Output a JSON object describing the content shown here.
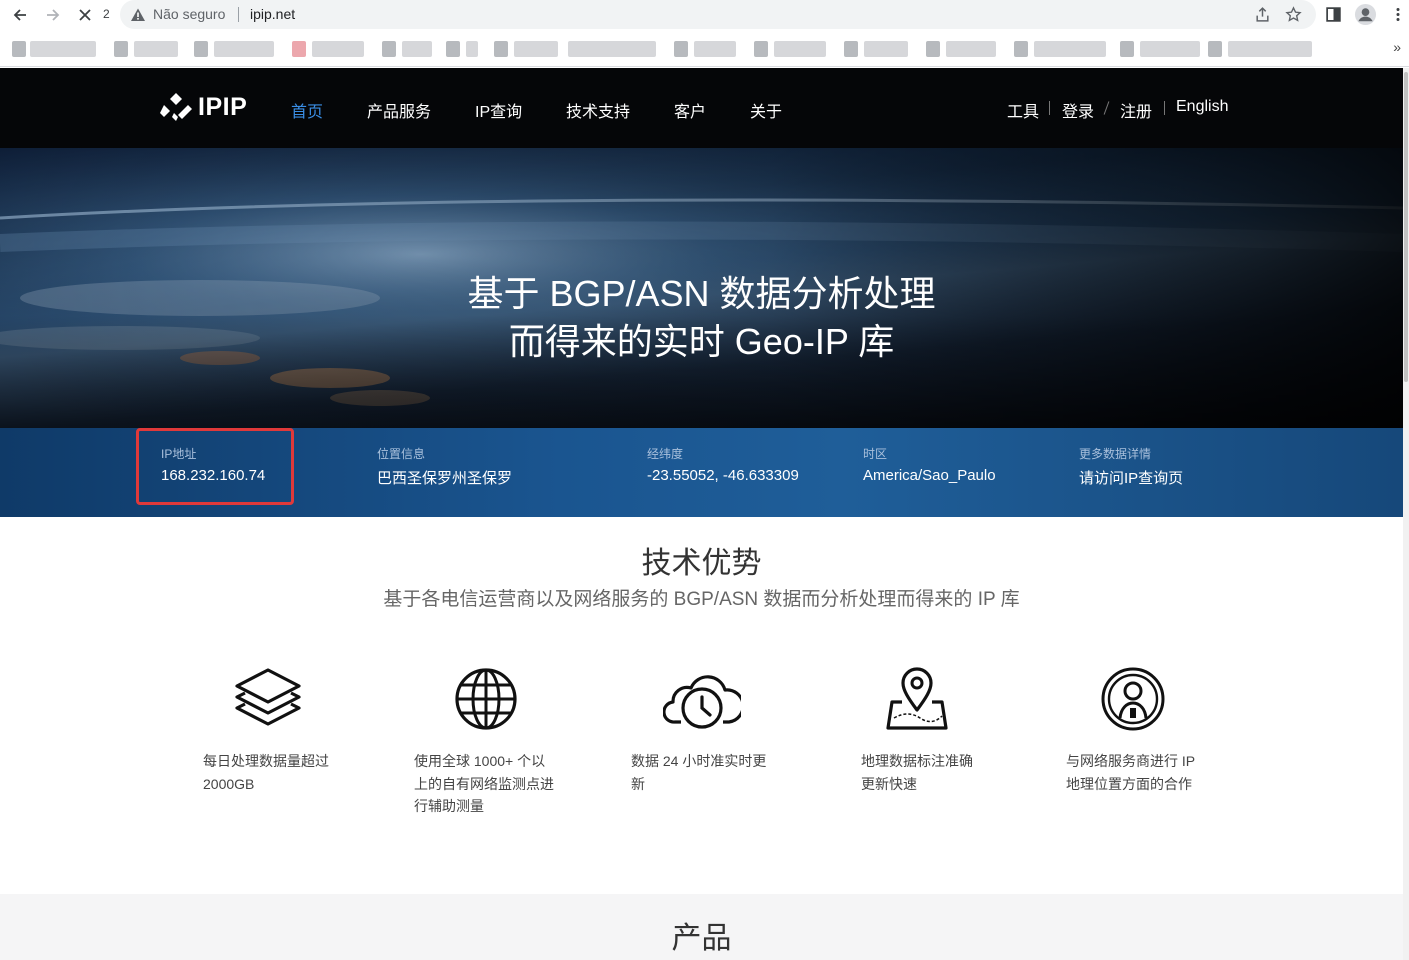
{
  "browser": {
    "tab_count": "2",
    "security_status": "Não seguro",
    "url": "ipip.net",
    "overflow": "»"
  },
  "site": {
    "logo_text": "IPIP",
    "nav": [
      "首页",
      "产品服务",
      "IP查询",
      "技术支持",
      "客户",
      "关于"
    ],
    "nav_right": [
      "工具",
      "登录",
      "注册",
      "English"
    ],
    "hero_line1": "基于 BGP/ASN 数据分析处理",
    "hero_line2": "而得来的实时 Geo-IP 库",
    "info": {
      "ip_label": "IP地址",
      "ip_value": "168.232.160.74",
      "location_label": "位置信息",
      "location_value": "巴西圣保罗州圣保罗",
      "coords_label": "经纬度",
      "coords_value": "-23.55052, -46.633309",
      "tz_label": "时区",
      "tz_value": "America/Sao_Paulo",
      "more_label": "更多数据详情",
      "more_value": "请访问IP查询页"
    },
    "advantages_title": "技术优势",
    "advantages_subtitle": "基于各电信运营商以及网络服务的 BGP/ASN 数据而分析处理而得来的 IP 库",
    "features": [
      {
        "icon": "layers-icon",
        "line1": "每日处理数据量超过",
        "line2": "2000GB",
        "line3": ""
      },
      {
        "icon": "globe-icon",
        "line1": "使用全球 1000+ 个以",
        "line2": "上的自有网络监测点进",
        "line3": "行辅助测量"
      },
      {
        "icon": "cloud-clock-icon",
        "line1": "数据 24 小时准实时更",
        "line2": "新",
        "line3": ""
      },
      {
        "icon": "map-pin-icon",
        "line1": "地理数据标注准确",
        "line2": "更新快速",
        "line3": ""
      },
      {
        "icon": "partner-icon",
        "line1": "与网络服务商进行 IP",
        "line2": "地理位置方面的合作",
        "line3": ""
      }
    ],
    "products_title": "产品"
  }
}
